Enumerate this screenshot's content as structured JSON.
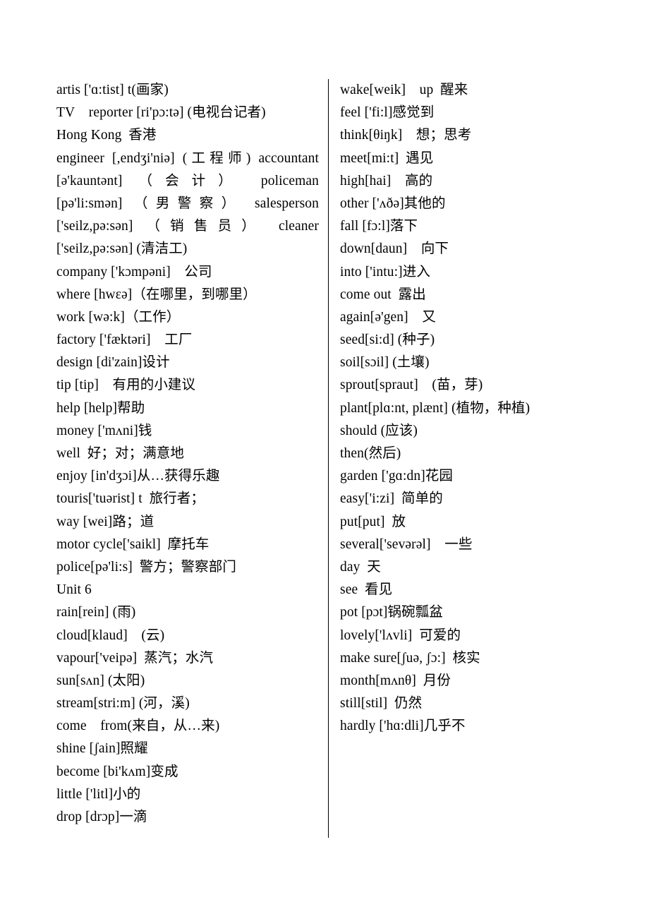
{
  "document": {
    "type": "vocabulary-list",
    "title": "",
    "columns": 2,
    "divider": true,
    "text_color": "#000000",
    "background_color": "#ffffff"
  },
  "left_column": {
    "entries": [
      {
        "text": "artis ['ɑ:tist] t(画家)",
        "justified": false
      },
      {
        "text": "TV reporter [ri'pɔ:tə] (电视台记者)",
        "justified": false
      },
      {
        "text": "Hong Kong 香港",
        "justified": false
      },
      {
        "text": "engineer [,endʒi'niə] (工程师) accountant",
        "justified": true
      },
      {
        "text": "[ə'kauntənt] （会计） policeman",
        "justified": true
      },
      {
        "text": "[pə'li:smən] （男警察） salesperson",
        "justified": true
      },
      {
        "text": "['seilz,pə:sən] （销售员） cleaner",
        "justified": true
      },
      {
        "text": "['seilz,pə:sən] (清洁工)",
        "justified": false
      },
      {
        "text": "company ['kɔmpəni] 公司",
        "justified": false
      },
      {
        "text": "where [hwɛə]（在哪里，到哪里）",
        "justified": false
      },
      {
        "text": "work [wə:k]（工作）",
        "justified": false
      },
      {
        "text": "factory ['fæktəri] 工厂",
        "justified": false
      },
      {
        "text": "design [di'zain]设计",
        "justified": false
      },
      {
        "text": "tip [tip] 有用的小建议",
        "justified": false
      },
      {
        "text": "help [help]帮助",
        "justified": false
      },
      {
        "text": "money ['mʌni]钱",
        "justified": false
      },
      {
        "text": "well 好；对；满意地",
        "justified": false
      },
      {
        "text": "enjoy [in'dʒɔi]从…获得乐趣",
        "justified": false
      },
      {
        "text": "touris['tuərist] t 旅行者；",
        "justified": false
      },
      {
        "text": "way [wei]路；道",
        "justified": false
      },
      {
        "text": "motor cycle['saikl] 摩托车",
        "justified": false
      },
      {
        "text": "police[pə'li:s] 警方；警察部门",
        "justified": false
      },
      {
        "text": "Unit 6",
        "justified": false
      },
      {
        "text": "rain[rein] (雨)",
        "justified": false
      },
      {
        "text": "cloud[klaud] (云)",
        "justified": false
      },
      {
        "text": "vapour['veipə] 蒸汽；水汽",
        "justified": false
      },
      {
        "text": "sun[sʌn] (太阳)",
        "justified": false
      },
      {
        "text": "stream[stri:m] (河，溪)",
        "justified": false
      },
      {
        "text": "come from(来自，从…来)",
        "justified": false
      },
      {
        "text": "shine [ʃain]照耀",
        "justified": false
      },
      {
        "text": "become [bi'kʌm]变成",
        "justified": false
      },
      {
        "text": "little ['litl]小的",
        "justified": false
      },
      {
        "text": "drop [drɔp]一滴",
        "justified": false
      }
    ]
  },
  "right_column": {
    "entries": [
      {
        "text": "wake[weik] up 醒来",
        "justified": false
      },
      {
        "text": "feel ['fi:l]感觉到",
        "justified": false
      },
      {
        "text": "think[θiŋk] 想；思考",
        "justified": false
      },
      {
        "text": "meet[mi:t] 遇见",
        "justified": false
      },
      {
        "text": "high[hai] 高的",
        "justified": false
      },
      {
        "text": "other ['ʌðə]其他的",
        "justified": false
      },
      {
        "text": "fall [fɔ:l]落下",
        "justified": false
      },
      {
        "text": "down[daun] 向下",
        "justified": false
      },
      {
        "text": "into ['intu:]进入",
        "justified": false
      },
      {
        "text": "come out 露出",
        "justified": false
      },
      {
        "text": "again[ə'gen] 又",
        "justified": false
      },
      {
        "text": "seed[si:d] (种子)",
        "justified": false
      },
      {
        "text": "soil[sɔil] (土壤)",
        "justified": false
      },
      {
        "text": "sprout[spraut] (苗，芽)",
        "justified": false
      },
      {
        "text": "plant[plɑ:nt, plænt] (植物，种植)",
        "justified": false
      },
      {
        "text": "should (应该)",
        "justified": false
      },
      {
        "text": "then(然后)",
        "justified": false
      },
      {
        "text": "garden ['gɑ:dn]花园",
        "justified": false
      },
      {
        "text": "easy['i:zi] 简单的",
        "justified": false
      },
      {
        "text": "put[put] 放",
        "justified": false
      },
      {
        "text": "several['sevərəl] 一些",
        "justified": false
      },
      {
        "text": "day 天",
        "justified": false
      },
      {
        "text": "see 看见",
        "justified": false
      },
      {
        "text": "pot [pɔt]锅碗瓢盆",
        "justified": false
      },
      {
        "text": "lovely['lʌvli] 可爱的",
        "justified": false
      },
      {
        "text": "make sure[ʃuə, ʃɔ:] 核实",
        "justified": false
      },
      {
        "text": "month[mʌnθ] 月份",
        "justified": false
      },
      {
        "text": "still[stil] 仍然",
        "justified": false
      },
      {
        "text": "hardly ['hɑ:dli]几乎不",
        "justified": false
      }
    ]
  }
}
